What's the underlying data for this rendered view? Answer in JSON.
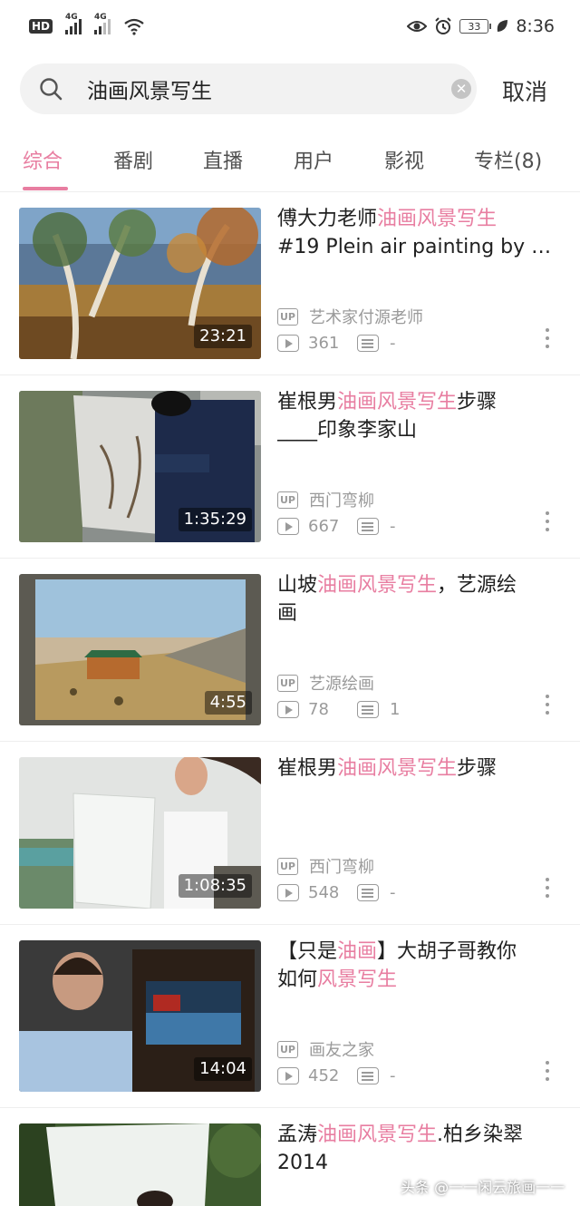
{
  "status_bar": {
    "hd": "HD",
    "sim1": "4G",
    "sim2": "4G",
    "battery": "33",
    "time": "8:36"
  },
  "search": {
    "query": "油画风景写生",
    "cancel_label": "取消"
  },
  "tabs": [
    "综合",
    "番剧",
    "直播",
    "用户",
    "影视",
    "专栏(8)"
  ],
  "active_tab": "综合",
  "colors": {
    "accent": "#e87ea1",
    "meta": "#9a9a9a"
  },
  "results": [
    {
      "title_pre": "傅大力老师",
      "title_hl": "油画风景写生",
      "title_post": "",
      "title_line2": "#19 Plein air painting by F...",
      "duration": "23:21",
      "uploader": "艺术家付源老师",
      "views": "361",
      "comments": "-"
    },
    {
      "title_pre": "崔根男",
      "title_hl": "油画风景写生",
      "title_post": "步骤",
      "title_line2": "____印象李家山",
      "duration": "1:35:29",
      "uploader": "西门弯柳",
      "views": "667",
      "comments": "-"
    },
    {
      "title_pre": "山坡",
      "title_hl": "油画风景写生",
      "title_post": "，艺源绘",
      "title_line2": "画",
      "duration": "4:55",
      "uploader": "艺源绘画",
      "views": "78",
      "comments": "1"
    },
    {
      "title_pre": "崔根男",
      "title_hl": "油画风景写生",
      "title_post": "步骤",
      "title_line2": "",
      "duration": "1:08:35",
      "uploader": "西门弯柳",
      "views": "548",
      "comments": "-"
    },
    {
      "title_pre": "【只是",
      "title_hl": "油画",
      "title_post": "】大胡子哥教你",
      "title_line2_pre": "如何",
      "title_line2_hl": "风景写生",
      "duration": "14:04",
      "uploader": "画友之家",
      "views": "452",
      "comments": "-"
    },
    {
      "title_pre": "孟涛",
      "title_hl": "油画风景写生",
      "title_post": ".柏乡染翠",
      "title_line2": "2014"
    }
  ],
  "watermark": "头条 @一一闲云旅画一一"
}
